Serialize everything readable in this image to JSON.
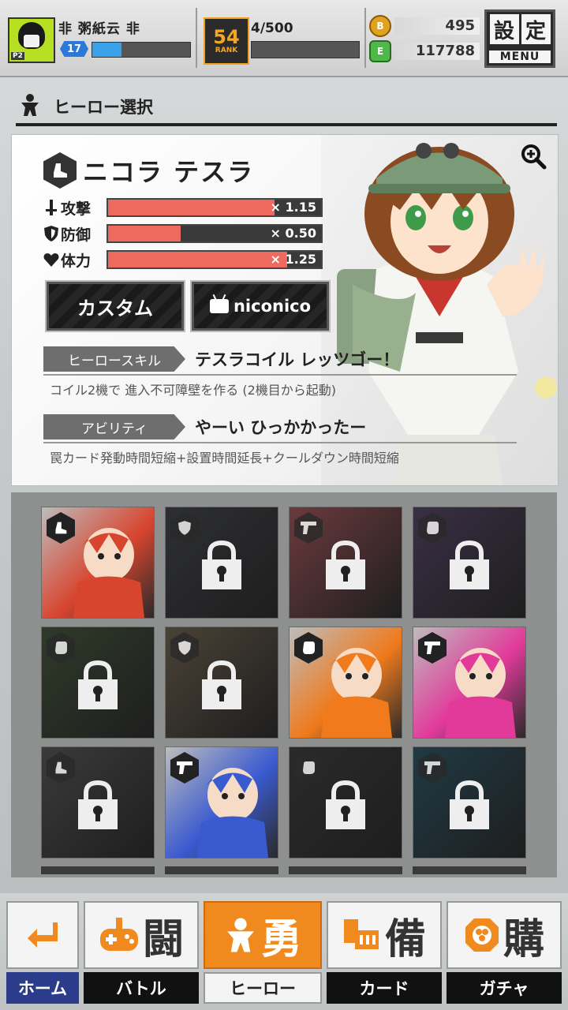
{
  "player": {
    "name": "非 粥紙云 非",
    "level": "17",
    "avatar_tag": "P2"
  },
  "rank": {
    "value": "54",
    "label": "RANK"
  },
  "stamina": {
    "text": "4/500"
  },
  "currency": {
    "gold_icon": "B",
    "gold": "495",
    "gem_icon": "E",
    "gems": "117788"
  },
  "menu": {
    "kanji_1": "設",
    "kanji_2": "定",
    "label": "MENU"
  },
  "section": {
    "title": "ヒーロー選択"
  },
  "hero": {
    "name": "ニコラ テスラ",
    "stats": [
      {
        "label": "攻撃",
        "icon": "sword-icon",
        "value": "× 1.15",
        "fill": 0.78
      },
      {
        "label": "防御",
        "icon": "shield-icon",
        "value": "× 0.50",
        "fill": 0.34
      },
      {
        "label": "体力",
        "icon": "heart-icon",
        "value": "× 1.25",
        "fill": 0.84
      }
    ],
    "custom_button": "カスタム",
    "nico_button": "niconico",
    "skill_tag": "ヒーロースキル",
    "skill_name": "テスラコイル レッツゴー！",
    "skill_desc": "コイル2機で 進入不可障壁を作る (2機目から起動)",
    "ability_tag": "アビリティ",
    "ability_name": "やーい ひっかかったー",
    "ability_desc": "罠カード発動時間短縮+設置時間延長+クールダウン時間短縮"
  },
  "roster": [
    {
      "class": "boot",
      "locked": false,
      "color": "#d8452f"
    },
    {
      "class": "shield",
      "locked": true,
      "color": "#2e2f33"
    },
    {
      "class": "gun",
      "locked": true,
      "color": "#6b3a3e"
    },
    {
      "class": "fist",
      "locked": true,
      "color": "#3a2f45"
    },
    {
      "class": "fist",
      "locked": true,
      "color": "#2f3a2a"
    },
    {
      "class": "shield",
      "locked": true,
      "color": "#4a4236"
    },
    {
      "class": "fist",
      "locked": false,
      "color": "#f07a1c"
    },
    {
      "class": "gun",
      "locked": false,
      "color": "#e23a9a"
    },
    {
      "class": "boot",
      "locked": true,
      "color": "#3a3a3a"
    },
    {
      "class": "gun",
      "locked": false,
      "color": "#3a5ad0"
    },
    {
      "class": "fist",
      "locked": true,
      "color": "#2a2a2a"
    },
    {
      "class": "gun",
      "locked": true,
      "color": "#203a44"
    }
  ],
  "nav": [
    {
      "kanji": "",
      "label": "ホーム",
      "icon": "back-arrow-icon"
    },
    {
      "kanji": "闘",
      "label": "バトル",
      "icon": "gamepad-icon"
    },
    {
      "kanji": "勇",
      "label": "ヒーロー",
      "icon": "hero-icon",
      "active": true
    },
    {
      "kanji": "備",
      "label": "カード",
      "icon": "cards-icon"
    },
    {
      "kanji": "購",
      "label": "ガチャ",
      "icon": "gacha-icon"
    }
  ]
}
